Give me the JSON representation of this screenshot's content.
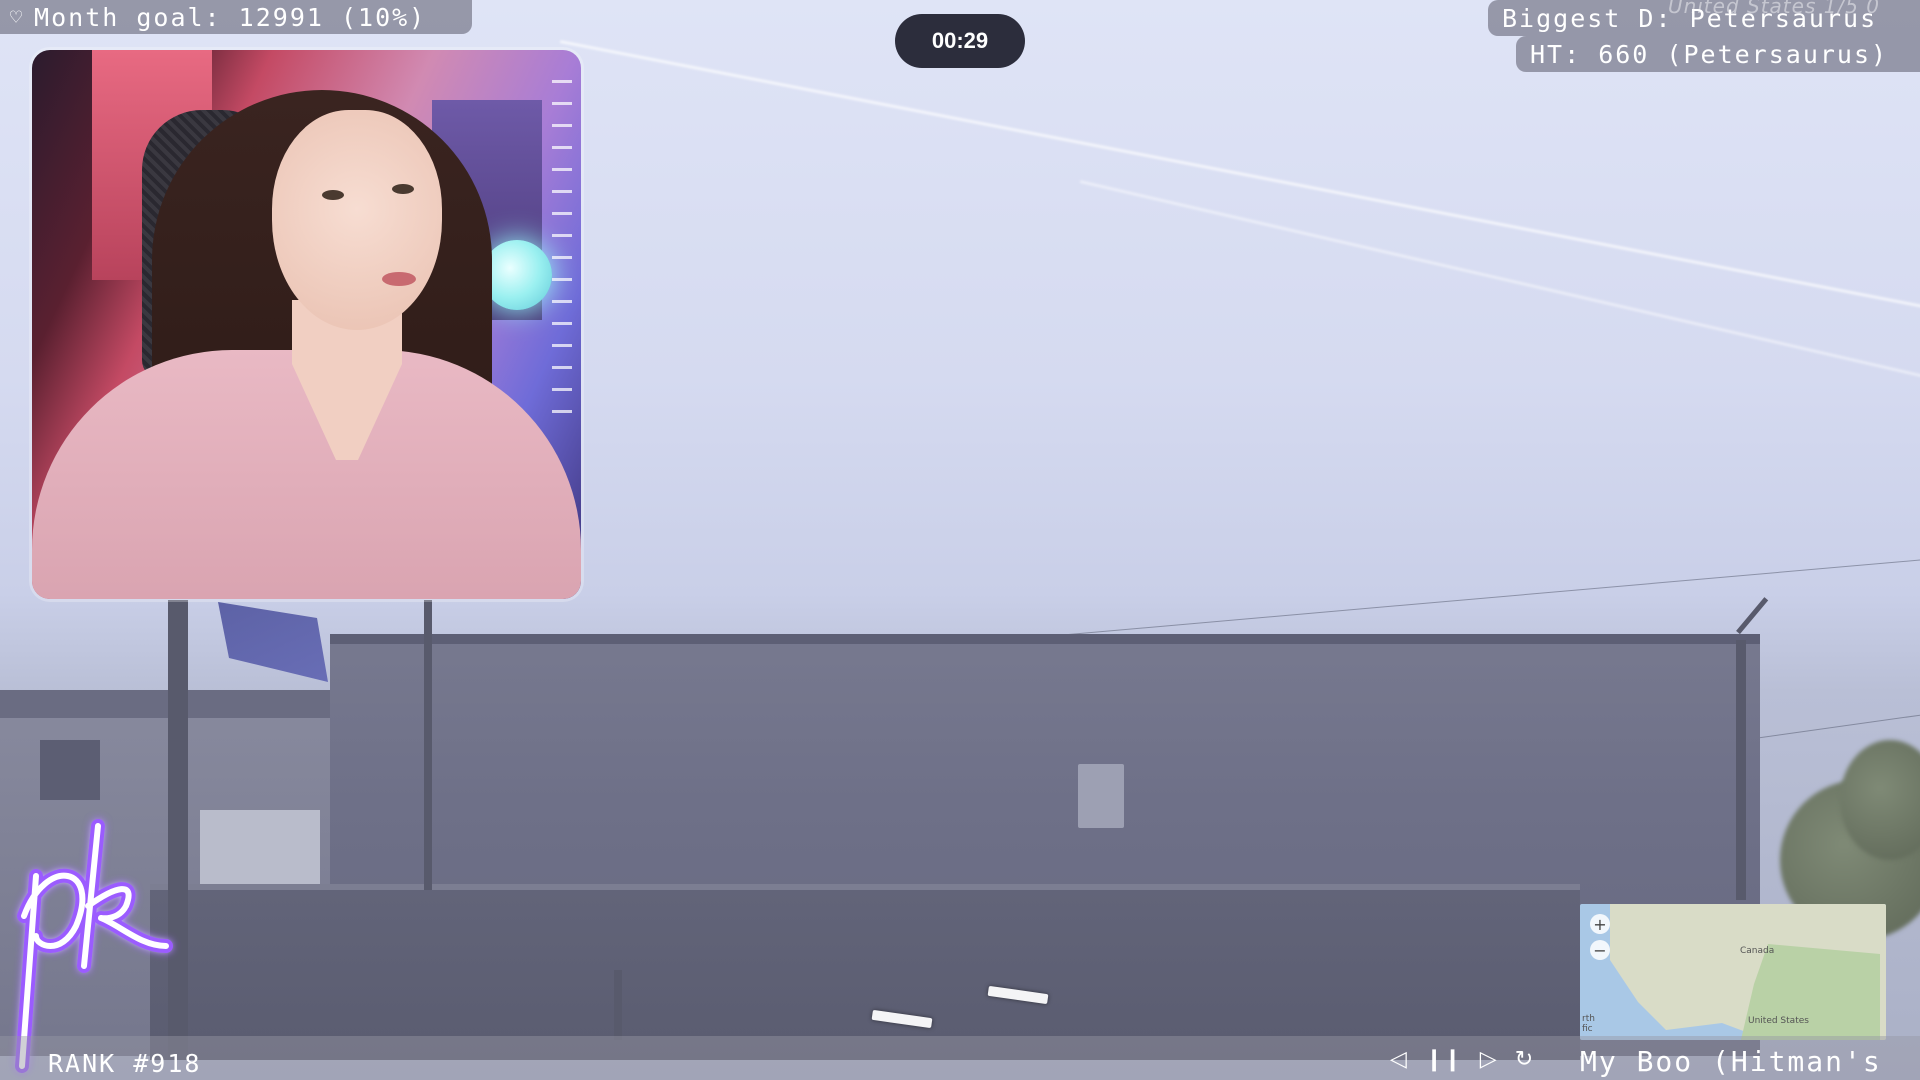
{
  "overlay": {
    "month_goal": "Month goal:  12991 (10%)",
    "biggest_donation": "Biggest D: Petersaurus",
    "high_tip": "HT: 660 (Petersaurus)",
    "faint_round_info": "United States    1/5    0",
    "timer": "00:29",
    "rank": "RANK #918",
    "song": "My Boo (Hitman's"
  },
  "logo": {
    "text": "pk"
  },
  "media_controls": {
    "prev": "◁",
    "pause": "❙❙",
    "next": "▷",
    "replay": "↻"
  },
  "minimap": {
    "zoom_in": "+",
    "zoom_out": "−",
    "label_canada": "Canada",
    "label_us": "United States",
    "label_pacific": "rth\nfic"
  },
  "colors": {
    "timer_bg": "#2c2d3c",
    "timer_progress": "#8a4cf0",
    "logo_stroke": "#ffffff",
    "logo_glow": "#9b5cff"
  },
  "timer_progress_fraction": 0.08
}
